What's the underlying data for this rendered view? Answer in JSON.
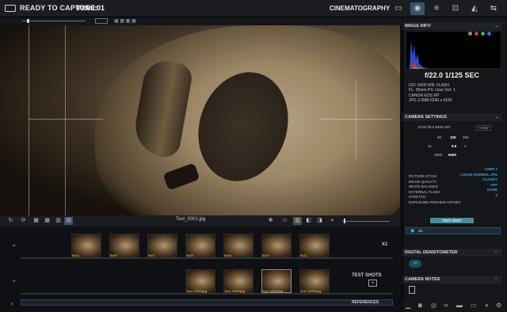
{
  "topbar": {
    "capture_label": "READY TO CAPTURE:",
    "timer": "00:00:01",
    "mode": "CINEMATOGRAPHY"
  },
  "filmstrip": {
    "current_file": "Test_0002.jpg",
    "row1_label": "X1",
    "row1_thumbs": [
      "0001",
      "0006",
      "0007",
      "0008",
      "0009",
      "0010",
      "0011"
    ],
    "row2_label": "TEST SHOTS",
    "row2_thumbs": [
      "Test_0004.jpg",
      "Test_0003.jpg",
      "Test_0002.jpg",
      "Test_0001.jpg"
    ],
    "row3_label": "REFERENCES"
  },
  "image_info": {
    "header": "IMAGE INFO",
    "exposure": "f/22.0   1/125 SEC",
    "meta_lines": [
      "ISO: 6400   WB: FLASH",
      "FL: 25mm   PS: User Def. 1",
      "CANON EOS RP",
      "JPG  2.0MB  6240 x 4160"
    ],
    "dot_colors": [
      "#8a8f96",
      "#d13b3b",
      "#3bb34a",
      "#3a6fd9"
    ]
  },
  "camera_settings": {
    "header": "CAMERA SETTINGS",
    "summary": "1/125  f/5.0  6400 ISO",
    "ev": "+ 0 EV",
    "dial_rows": [
      [
        "",
        "60",
        "125",
        "250"
      ],
      [
        "11",
        "",
        "5.6",
        "4"
      ],
      [
        "",
        "3200",
        "6400",
        ""
      ]
    ],
    "settings": [
      {
        "label": "PICTURE STYLE",
        "value": "USER 1"
      },
      {
        "label": "IMAGE QUALITY",
        "value": "LARGE NORMAL JPG"
      },
      {
        "label": "WHITE BALANCE",
        "value": "CLOUDY"
      },
      {
        "label": "EXTERNAL FLASH",
        "value": "OFF"
      },
      {
        "label": "STRETCH",
        "value": "NONE"
      },
      {
        "label": "EXPOSURE PREVIEW OFFSET",
        "value": "0"
      }
    ],
    "test_shot": "TEST SHOT",
    "counter": "X1"
  },
  "densitometer": {
    "header": "DIGITAL DENSITOMETER"
  },
  "camera_notes": {
    "header": "CAMERA NOTES"
  }
}
